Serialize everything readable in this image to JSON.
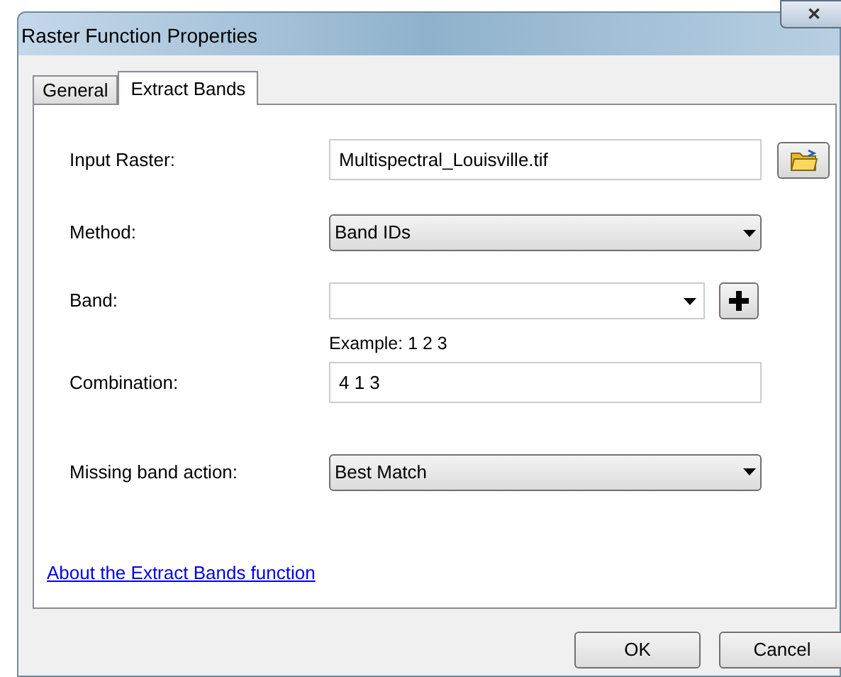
{
  "window": {
    "title": "Raster Function Properties",
    "close": "✕"
  },
  "tabs": [
    {
      "label": "General",
      "selected": false
    },
    {
      "label": "Extract Bands",
      "selected": true
    }
  ],
  "fields": [
    {
      "kind": "text",
      "label": "Input Raster:",
      "value": "Multispectral_Louisville.tif",
      "browse": true
    },
    {
      "kind": "dropdown",
      "label": "Method:",
      "value": "Band IDs"
    },
    {
      "kind": "combo",
      "label": "Band:",
      "add": true
    },
    {
      "kind": "text",
      "label": "Combination:",
      "hint": "Example: 1 2 3",
      "value": "4 1 3"
    },
    {
      "kind": "dropdown",
      "label": "Missing band action:",
      "value": "Best Match"
    }
  ],
  "help_link": "About the Extract Bands function",
  "buttons": [
    "OK",
    "Cancel"
  ]
}
